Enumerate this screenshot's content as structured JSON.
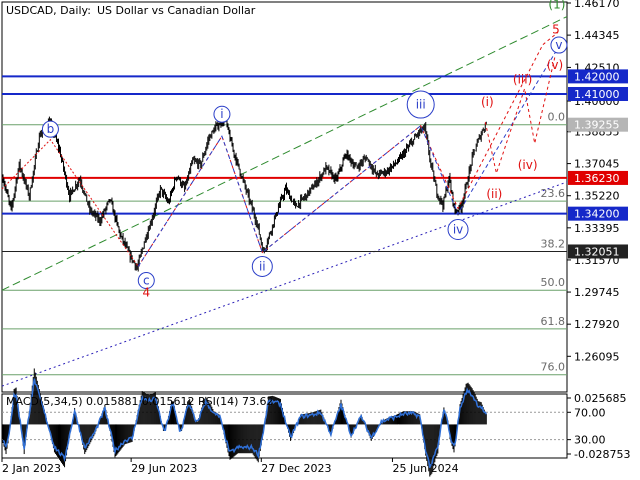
{
  "header": {
    "symbol": "USDCAD, Daily:",
    "description": "US Dollar vs Canadian Dollar"
  },
  "colors": {
    "background": "#ffffff",
    "candles": "#000000",
    "grid": "#c8c8c8",
    "blue_level": "#1528c9",
    "red_level": "#e00000",
    "fib_line": "#6aa06a",
    "wave_blue": "#2a3ec8",
    "wave_red": "#e01010",
    "wave_green": "#2e8b2e",
    "macd_hist": "#000000",
    "rsi_line": "#2f6fd6"
  },
  "chart_data": {
    "type": "candlestick",
    "title": "USDCAD, Daily: US Dollar vs Canadian Dollar",
    "xlabel": "",
    "ylabel": "",
    "ylim": [
      1.2418,
      1.4617
    ],
    "y_tick_labels": [
      "1.46170",
      "1.44345",
      "1.42510",
      "1.40600",
      "1.38855",
      "1.37045",
      "1.35220",
      "1.33395",
      "1.31570",
      "1.29745",
      "1.27920",
      "1.26095"
    ],
    "y_tick_values": [
      1.4617,
      1.44345,
      1.4251,
      1.406,
      1.38855,
      1.37045,
      1.3522,
      1.33395,
      1.3157,
      1.29745,
      1.2792,
      1.26095
    ],
    "x_tick_labels": [
      "2 Jan 2023",
      "29 Jun 2023",
      "27 Dec 2023",
      "25 Jun 2024"
    ],
    "level_boxes": [
      {
        "price": 1.42,
        "label": "1.42000",
        "color": "blue"
      },
      {
        "price": 1.41,
        "label": "1.41000",
        "color": "blue"
      },
      {
        "price": 1.39255,
        "label": "1.39255",
        "color": "gray"
      },
      {
        "price": 1.3623,
        "label": "1.36230",
        "color": "red"
      },
      {
        "price": 1.342,
        "label": "1.34200",
        "color": "blue"
      },
      {
        "price": 1.32051,
        "label": "1.32051",
        "color": "dark"
      }
    ],
    "fibonacci": [
      {
        "label": "0.0",
        "price": 1.39255
      },
      {
        "label": "23.6",
        "price": 1.3491
      },
      {
        "label": "38.2",
        "price": 1.32051
      },
      {
        "label": "50.0",
        "price": 1.2985
      },
      {
        "label": "61.8",
        "price": 1.2765
      },
      {
        "label": "76.0",
        "price": 1.2505
      }
    ],
    "price_path": [
      [
        0,
        1.362
      ],
      [
        8,
        1.344
      ],
      [
        16,
        1.37
      ],
      [
        26,
        1.352
      ],
      [
        36,
        1.386
      ],
      [
        46,
        1.395
      ],
      [
        56,
        1.378
      ],
      [
        66,
        1.352
      ],
      [
        76,
        1.362
      ],
      [
        86,
        1.344
      ],
      [
        96,
        1.338
      ],
      [
        106,
        1.35
      ],
      [
        116,
        1.33
      ],
      [
        126,
        1.318
      ],
      [
        133,
        1.311
      ],
      [
        140,
        1.326
      ],
      [
        148,
        1.34
      ],
      [
        156,
        1.356
      ],
      [
        164,
        1.348
      ],
      [
        172,
        1.364
      ],
      [
        180,
        1.356
      ],
      [
        188,
        1.372
      ],
      [
        196,
        1.37
      ],
      [
        204,
        1.385
      ],
      [
        212,
        1.392
      ],
      [
        220,
        1.396
      ],
      [
        228,
        1.378
      ],
      [
        236,
        1.364
      ],
      [
        244,
        1.35
      ],
      [
        252,
        1.336
      ],
      [
        258,
        1.32
      ],
      [
        264,
        1.33
      ],
      [
        272,
        1.344
      ],
      [
        280,
        1.356
      ],
      [
        290,
        1.346
      ],
      [
        300,
        1.352
      ],
      [
        310,
        1.359
      ],
      [
        320,
        1.368
      ],
      [
        330,
        1.361
      ],
      [
        340,
        1.376
      ],
      [
        350,
        1.368
      ],
      [
        360,
        1.374
      ],
      [
        370,
        1.364
      ],
      [
        380,
        1.366
      ],
      [
        392,
        1.372
      ],
      [
        402,
        1.38
      ],
      [
        412,
        1.388
      ],
      [
        418,
        1.391
      ],
      [
        424,
        1.37
      ],
      [
        430,
        1.354
      ],
      [
        436,
        1.347
      ],
      [
        442,
        1.362
      ],
      [
        448,
        1.343
      ],
      [
        454,
        1.346
      ],
      [
        460,
        1.36
      ],
      [
        466,
        1.376
      ],
      [
        472,
        1.385
      ],
      [
        479,
        1.394
      ]
    ],
    "macd_rsi": {
      "label": "MACD(5,34,5) 0.015881 0.015612 RSI(14) 73.62",
      "tick_labels": [
        "0.025685",
        "70.00",
        "30.00",
        "-0.028753"
      ],
      "tick_values": [
        0.025685,
        70,
        30,
        -0.028753
      ]
    },
    "wave_labels": [
      {
        "text": "(1)",
        "color": "green",
        "circled": false,
        "date_index": 550,
        "price": 1.4608
      },
      {
        "text": "5",
        "color": "red",
        "circled": false,
        "date_index": 549,
        "price": 1.4467
      },
      {
        "text": "v",
        "color": "blue",
        "circled": true,
        "date_index": 552,
        "price": 1.4378
      },
      {
        "text": "(v)",
        "color": "red",
        "circled": false,
        "date_index": 548,
        "price": 1.4265
      },
      {
        "text": "(iii)",
        "color": "red",
        "circled": false,
        "date_index": 516,
        "price": 1.4183
      },
      {
        "text": "(i)",
        "color": "red",
        "circled": false,
        "date_index": 481,
        "price": 1.4055
      },
      {
        "text": "(iv)",
        "color": "red",
        "circled": false,
        "date_index": 521,
        "price": 1.3697
      },
      {
        "text": "(ii)",
        "color": "red",
        "circled": false,
        "date_index": 488,
        "price": 1.3533
      },
      {
        "text": "b",
        "color": "blue",
        "circled": true,
        "date_index": 48,
        "price": 1.39
      },
      {
        "text": "i",
        "color": "blue",
        "circled": true,
        "date_index": 218,
        "price": 1.3985
      },
      {
        "text": "iii",
        "color": "blue",
        "circled": true,
        "date_index": 415,
        "price": 1.404
      },
      {
        "text": "c",
        "color": "blue",
        "circled": true,
        "date_index": 143,
        "price": 1.304
      },
      {
        "text": "4",
        "color": "red",
        "circled": false,
        "date_index": 143,
        "price": 1.2973
      },
      {
        "text": "ii",
        "color": "blue",
        "circled": true,
        "date_index": 258,
        "price": 1.312
      },
      {
        "text": "iv",
        "color": "blue",
        "circled": true,
        "date_index": 452,
        "price": 1.333
      }
    ]
  }
}
